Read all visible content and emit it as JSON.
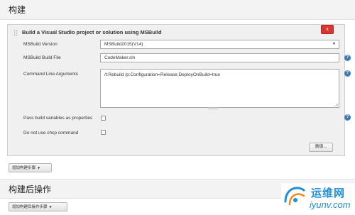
{
  "build_section": {
    "title": "构建"
  },
  "msbuild_step": {
    "title": "Build a Visual Studio project or solution using MSBuild",
    "delete_label": "x",
    "fields": {
      "version_label": "MSBuild Version",
      "version_value": "MSBuild2015(V14)",
      "build_file_label": "MSBuild Build File",
      "build_file_value": "CodeMaker.sln",
      "args_label": "Command Line Arguments",
      "args_value": "/t:Rebuild /p:Configuration=Release;DeployOnBuild=true",
      "pass_vars_label": "Pass build variables as properties",
      "pass_vars_checked": false,
      "no_chcp_label": "Do not use chcp command",
      "no_chcp_checked": false
    },
    "help_icon_glyph": "?",
    "advanced_label": "高级..."
  },
  "add_build_step_label": "增加构建步骤",
  "post_build_section": {
    "title": "构建后操作"
  },
  "add_post_build_step_label": "增加构建后操作步骤",
  "watermark": {
    "cn_text": "运维网",
    "url_text": "iyunv.com"
  },
  "colors": {
    "delete_button": "#d9362f",
    "help_icon": "#3d7ab6",
    "watermark": "#1f8fd6"
  }
}
